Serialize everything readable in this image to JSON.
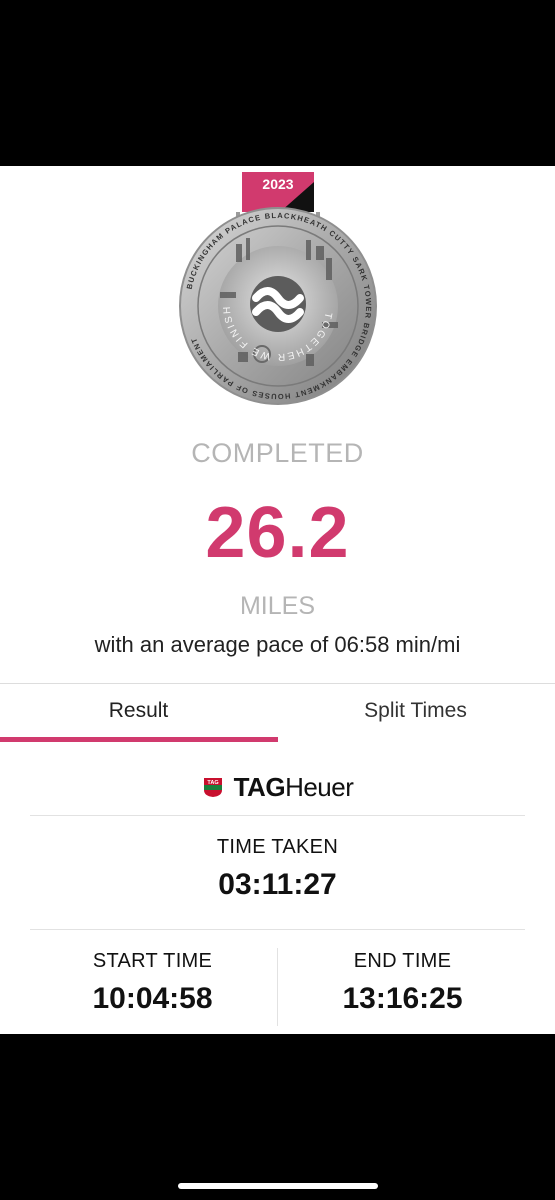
{
  "medal": {
    "year": "2023",
    "center_text": "TOGETHER WE FINISHED",
    "ring_text": "BUCKINGHAM PALACE  BLACKHEATH  CUTTY SARK  TOWER BRIDGE  EMBANKMENT  HOUSES OF PARLIAMENT",
    "colors": {
      "ribbon": "#d13a6e",
      "ribbon_dark": "#111111",
      "metal": "#a9a9a9"
    }
  },
  "summary": {
    "status": "COMPLETED",
    "distance": "26.2",
    "unit": "MILES",
    "pace": "with an average pace of 06:58 min/mi"
  },
  "tabs": [
    {
      "label": "Result",
      "active": true
    },
    {
      "label": "Split Times",
      "active": false
    }
  ],
  "sponsor": {
    "tag": "TAG",
    "heuer_bold": "TAG",
    "heuer_rest": "Heuer",
    "logo_colors": [
      "#c8102e",
      "#1a7f3c"
    ]
  },
  "result": {
    "time_taken_label": "TIME TAKEN",
    "time_taken": "03:11:27",
    "start_label": "START TIME",
    "start_time": "10:04:58",
    "end_label": "END TIME",
    "end_time": "13:16:25"
  },
  "theme": {
    "accent": "#d13a6e",
    "muted": "#b5b5b5"
  }
}
